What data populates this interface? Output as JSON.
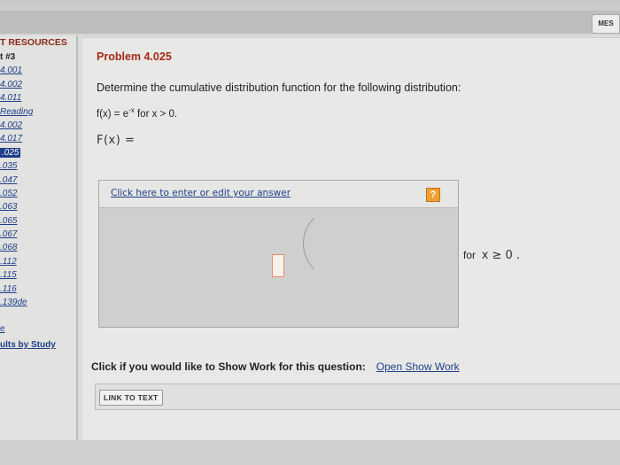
{
  "header": {
    "message_button": "MES"
  },
  "sidebar": {
    "heading": "T RESOURCES",
    "items": [
      {
        "label": "t #3",
        "kind": "plain"
      },
      {
        "label": "4.001",
        "kind": "link"
      },
      {
        "label": "4.002",
        "kind": "link"
      },
      {
        "label": "4.011",
        "kind": "link"
      },
      {
        "label": "Reading",
        "kind": "link"
      },
      {
        "label": "4.002",
        "kind": "link"
      },
      {
        "label": "4.017",
        "kind": "link"
      },
      {
        "label": ".025",
        "kind": "selected"
      },
      {
        "label": ".035",
        "kind": "link"
      },
      {
        "label": ".047",
        "kind": "link"
      },
      {
        "label": ".052",
        "kind": "link"
      },
      {
        "label": ".063",
        "kind": "link"
      },
      {
        "label": ".065",
        "kind": "link"
      },
      {
        "label": ".067",
        "kind": "link"
      },
      {
        "label": ".068",
        "kind": "link"
      },
      {
        "label": ".112",
        "kind": "link"
      },
      {
        "label": ".115",
        "kind": "link"
      },
      {
        "label": ".116",
        "kind": "link"
      },
      {
        "label": ".139de",
        "kind": "link"
      }
    ],
    "footer_e": "e",
    "footer": "ults by Study"
  },
  "problem": {
    "title": "Problem 4.025",
    "question": "Determine the cumulative distribution function for the following distribution:",
    "fx_prefix": "f(x) = e",
    "fx_exp": "-x",
    "fx_suffix": " for x > 0.",
    "Fx_label": "F(x)  ="
  },
  "answer": {
    "link_text": "Click here to enter or edit your answer",
    "help_icon": "?",
    "for_text": "for",
    "condition": "x ≥ 0 ."
  },
  "showwork": {
    "prompt": "Click if you would like to Show Work for this question:",
    "link": "Open Show Work"
  },
  "link_to_text": "LINK TO TEXT"
}
